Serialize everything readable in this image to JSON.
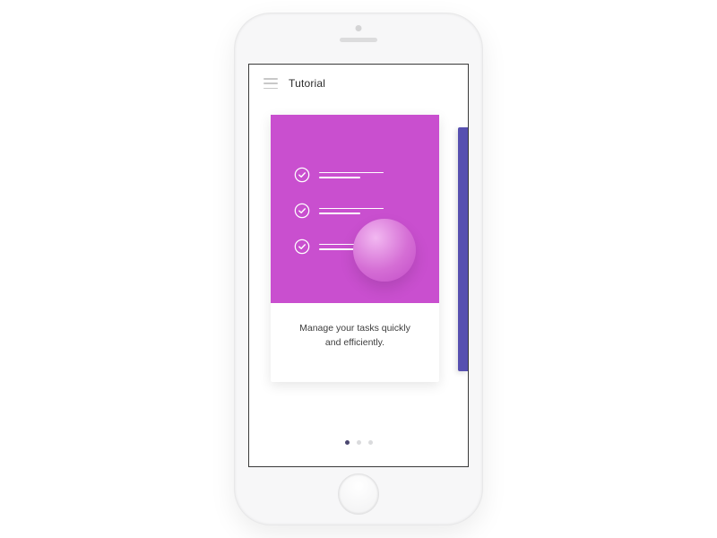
{
  "header": {
    "title": "Tutorial",
    "menu_icon": "menu-icon"
  },
  "carousel": {
    "active_index": 0,
    "total_slides": 3,
    "cards": [
      {
        "image_bg": "#c94fcf",
        "caption": "Manage your tasks quickly\nand efficiently.",
        "illustration": "checklist-sphere"
      }
    ],
    "peek_color": "#5750b0"
  },
  "dots": {
    "colors": {
      "active": "#4b4770",
      "inactive": "#dadbdd"
    }
  }
}
